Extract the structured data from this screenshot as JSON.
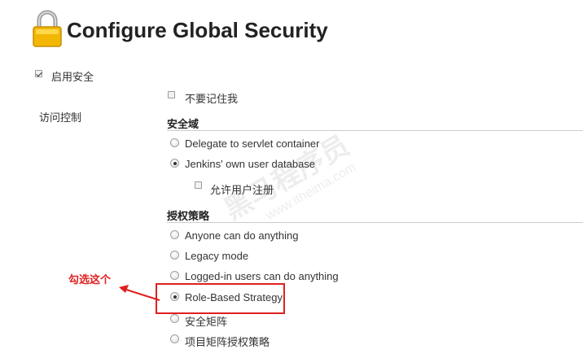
{
  "page": {
    "title": "Configure Global Security"
  },
  "enable_security": {
    "label": "启用安全",
    "checked": true
  },
  "access_control": {
    "label": "访问控制",
    "remember_me": {
      "label": "不要记住我",
      "checked": false
    }
  },
  "security_realm": {
    "title": "安全域",
    "options": [
      {
        "label": "Delegate to servlet container",
        "selected": false
      },
      {
        "label": "Jenkins' own user database",
        "selected": true
      }
    ],
    "allow_signup": {
      "label": "允许用户注册",
      "checked": false
    }
  },
  "authorization": {
    "title": "授权策略",
    "options": [
      {
        "label": "Anyone can do anything",
        "selected": false
      },
      {
        "label": "Legacy mode",
        "selected": false
      },
      {
        "label": "Logged-in users can do anything",
        "selected": false
      },
      {
        "label": "Role-Based Strategy",
        "selected": true
      },
      {
        "label": "安全矩阵",
        "selected": false
      },
      {
        "label": "项目矩阵授权策略",
        "selected": false
      }
    ]
  },
  "annotation": {
    "text": "勾选这个",
    "color": "#e02020"
  },
  "watermark": {
    "main": "黑马程序员",
    "sub": "www.itheima.com"
  },
  "icons": {
    "lock": "padlock-icon"
  }
}
